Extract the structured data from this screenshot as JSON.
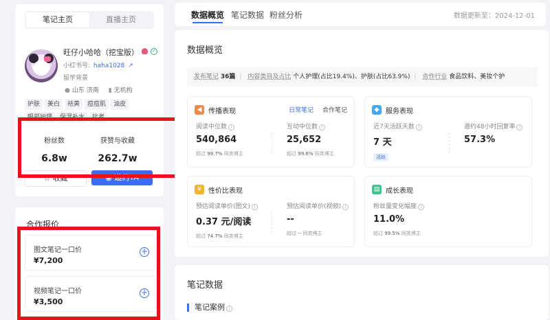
{
  "profile": {
    "tabs": [
      "笔记主页",
      "直播主页"
    ],
    "name": "旺仔小哈哈（挖宝版）",
    "xhs_label": "小红书号:",
    "xhs_id": "haha1028",
    "study": "留学背景",
    "location": "山东 济南",
    "org": "无机构",
    "tags": [
      "护肤",
      "美白",
      "祛黄",
      "痘痘肌",
      "油皮",
      "眼部护理",
      "保湿补水",
      "抗老"
    ],
    "stats": {
      "fans_label": "粉丝数",
      "fans_value": "6.8w",
      "likes_label": "获赞与收藏",
      "likes_value": "262.7w"
    },
    "collect_label": "收藏",
    "invite_label": "邀约TA"
  },
  "pricing": {
    "title": "合作报价",
    "items": [
      {
        "label": "图文笔记一口价",
        "value": "¥7,200"
      },
      {
        "label": "视频笔记一口价",
        "value": "¥3,500"
      }
    ]
  },
  "tabs": {
    "items": [
      "数据概览",
      "笔记数据",
      "粉丝分析"
    ],
    "update": "数据更新至：2024-12-01"
  },
  "overview": {
    "title": "数据概览",
    "summary": {
      "k1": "发布笔记",
      "v1": "36篇",
      "k2": "内容类目及占比",
      "v2": "个人护理(占比19.4%)、护肤(占比63.9%)",
      "k3": "合作行业",
      "v3": "食品饮料、美妆个护"
    },
    "spread": {
      "title": "传播表现",
      "tab_daily": "日常笔记",
      "tab_coop": "合作笔记",
      "m1_label": "阅读中位数",
      "m1_value": "540,864",
      "m1_pre": "超过",
      "m1_pct": "99.7%",
      "m1_post": "同类博主",
      "m2_label": "互动中位数",
      "m2_value": "25,652",
      "m2_pre": "超过",
      "m2_pct": "99.6%",
      "m2_post": "同类博主"
    },
    "service": {
      "title": "服务表现",
      "m1_label": "近7天活跃天数",
      "m1_value": "7 天",
      "m1_tag": "活跃",
      "m2_label": "邀约48小时回复率",
      "m2_value": "57.3%"
    },
    "value": {
      "title": "性价比表现",
      "m1_label": "预估阅读单价(图文)",
      "m1_value": "0.37 元/阅读",
      "m1_pre": "超过",
      "m1_pct": "74.7%",
      "m1_post": "同类博主",
      "m2_label": "预估阅读单价(视频)",
      "m2_value": "--",
      "m2_pre": "超过",
      "m2_pct": "--",
      "m2_post": "同类博主"
    },
    "growth": {
      "title": "成长表现",
      "m1_label": "粉丝量变化幅度",
      "m1_value": "11.0%",
      "m1_pre": "超过",
      "m1_pct": "99.5%",
      "m1_post": "同类博主"
    }
  },
  "note_data": {
    "title": "笔记数据",
    "sub": "笔记案例"
  },
  "colors": {
    "accent": "#3b6df2",
    "highlight": "#e8121b"
  }
}
